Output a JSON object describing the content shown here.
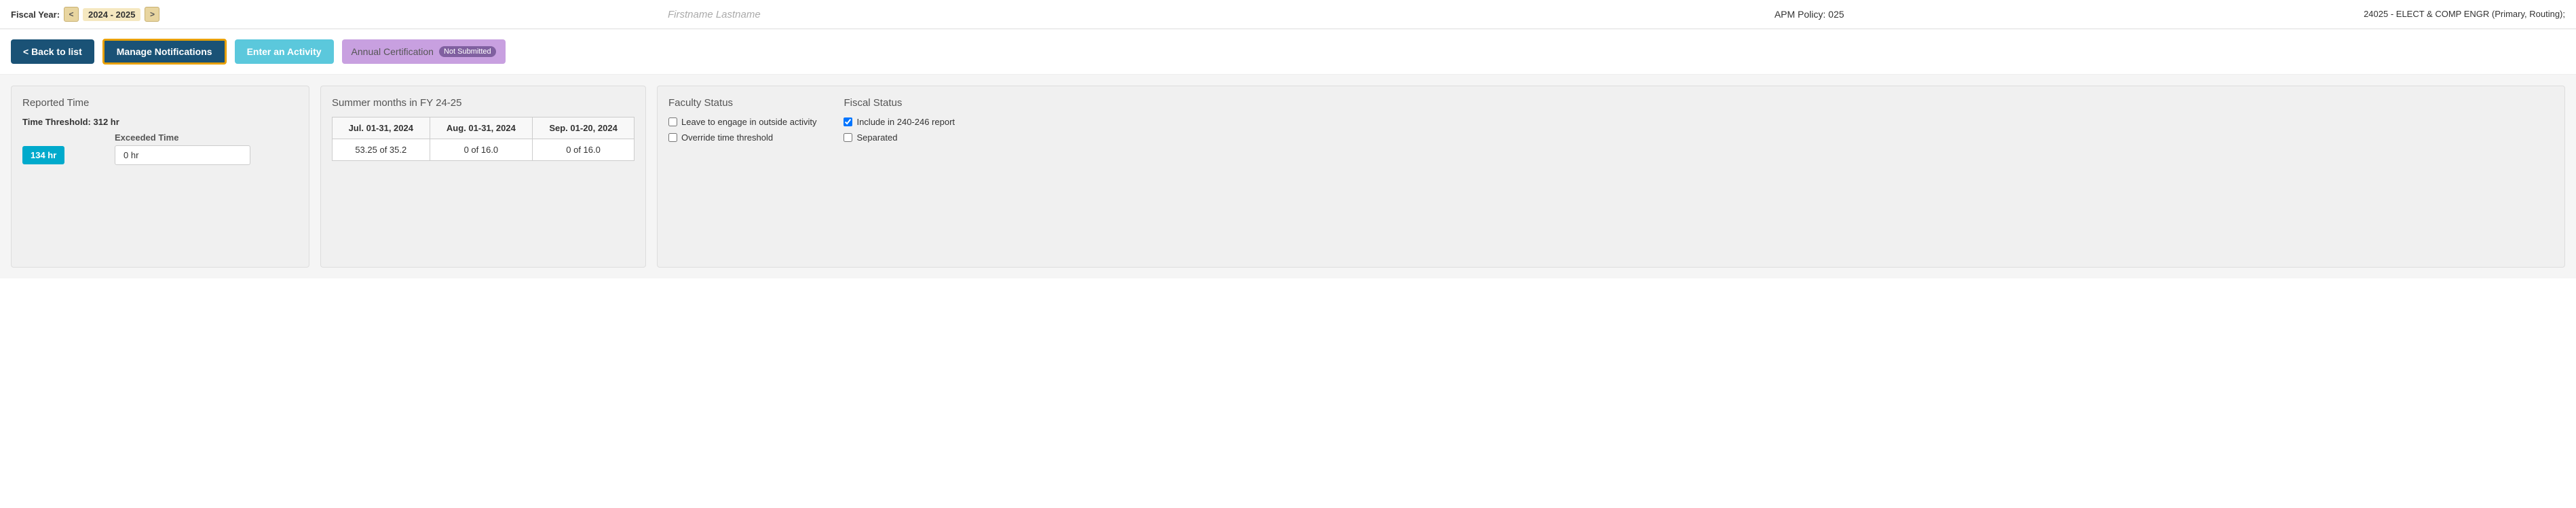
{
  "header": {
    "fiscal_year_label": "Fiscal Year:",
    "prev_btn": "<",
    "next_btn": ">",
    "fiscal_year_value": "2024 - 2025",
    "person_name": "Firstname Lastname",
    "apm_policy": "APM Policy: 025",
    "dept_info": "24025 - ELECT & COMP ENGR (Primary, Routing);"
  },
  "actions": {
    "back_label": "< Back to list",
    "manage_label": "Manage Notifications",
    "enter_label": "Enter an Activity",
    "certification_label": "Annual Certification",
    "not_submitted_badge": "Not Submitted"
  },
  "reported_time": {
    "title": "Reported Time",
    "threshold_label": "Time Threshold: 312 hr",
    "col1_header": "",
    "col2_header": "Exceeded Time",
    "time_bar_value": "134 hr",
    "exceeded_value": "0 hr"
  },
  "summer": {
    "title": "Summer months in FY 24-25",
    "columns": [
      "Jul. 01-31, 2024",
      "Aug. 01-31, 2024",
      "Sep. 01-20, 2024"
    ],
    "values": [
      "53.25 of 35.2",
      "0 of 16.0",
      "0 of 16.0"
    ]
  },
  "faculty_status": {
    "title": "Faculty Status",
    "options": [
      {
        "label": "Leave to engage in outside activity",
        "checked": false
      },
      {
        "label": "Override time threshold",
        "checked": false
      }
    ]
  },
  "fiscal_status": {
    "title": "Fiscal Status",
    "options": [
      {
        "label": "Include in 240-246 report",
        "checked": true
      },
      {
        "label": "Separated",
        "checked": false
      }
    ]
  }
}
